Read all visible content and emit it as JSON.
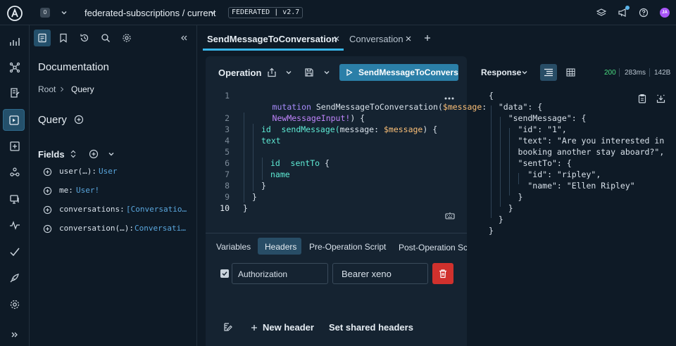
{
  "topbar": {
    "org_badge": "0",
    "graph_title": "federated-subscriptions / current",
    "federation_badge": "FEDERATED | v2.7",
    "avatar_initials": "JA"
  },
  "docs": {
    "title": "Documentation",
    "breadcrumb_root": "Root",
    "breadcrumb_current": "Query",
    "type_heading": "Query",
    "fields_heading": "Fields",
    "fields": [
      {
        "name": "user(…):",
        "type": "User"
      },
      {
        "name": "me:",
        "type": "User!"
      },
      {
        "name": "conversations:",
        "type": "[Conversatio…"
      },
      {
        "name": "conversation(…):",
        "type": "Conversati…"
      }
    ]
  },
  "tabs": [
    {
      "label": "SendMessageToConversation",
      "active": true
    },
    {
      "label": "Conversation",
      "active": false
    }
  ],
  "operation": {
    "label": "Operation",
    "run_button": "SendMessageToConversa",
    "line_numbers": [
      "1",
      "2",
      "3",
      "4",
      "5",
      "6",
      "7",
      "8",
      "9",
      "10"
    ]
  },
  "code": {
    "l1_kw": "mutation",
    "l1_name": "SendMessageToConversation(",
    "l1_var": "$message",
    "l1_colon": ":",
    "l1b_type": "NewMessageInput!",
    "l1b_rest": ") {",
    "l2_field": "sendMessage(",
    "l2_arg": "message:",
    "l2_var": "$message",
    "l2_rest": ") {",
    "l3": "id",
    "l4": "text",
    "l5_field": "sentTo",
    "l5_rest": "{",
    "l6": "id",
    "l7": "name",
    "l8": "}",
    "l9": "}",
    "l10": "}"
  },
  "bottom_tabs": [
    "Variables",
    "Headers",
    "Pre-Operation Script",
    "Post-Operation Scr"
  ],
  "headers": {
    "key_value": "Authorization",
    "value_value": "Bearer xeno",
    "new_header": "New header",
    "shared_headers": "Set shared headers"
  },
  "response": {
    "label": "Response",
    "status": "200",
    "time": "283ms",
    "size": "142B",
    "lines": [
      "{",
      "  \"data\": {",
      "    \"sendMessage\": {",
      "      \"id\": \"1\",",
      "      \"text\": \"Are you interested in",
      "      booking another stay aboard?\",",
      "      \"sentTo\": {",
      "        \"id\": \"ripley\",",
      "        \"name\": \"Ellen Ripley\"",
      "      }",
      "    }",
      "  }",
      "}"
    ]
  },
  "colors": {
    "accent": "#2b7fa8",
    "active_tab_underline": "#38b5e8",
    "delete": "#d0312d",
    "status_ok": "#4ade80"
  }
}
